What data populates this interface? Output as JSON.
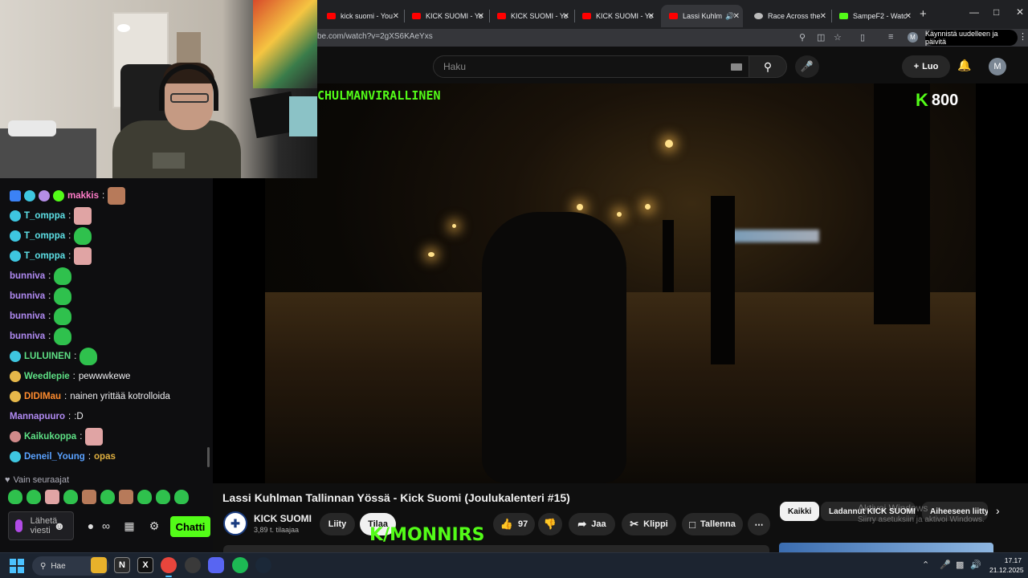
{
  "browser": {
    "tabs": [
      {
        "label": "kick suomi - You",
        "favicon": "youtube-icon"
      },
      {
        "label": "KICK SUOMI - Yo",
        "favicon": "youtube-icon"
      },
      {
        "label": "KICK SUOMI - Yo",
        "favicon": "youtube-icon"
      },
      {
        "label": "KICK SUOMI - Yo",
        "favicon": "youtube-icon"
      },
      {
        "label": "Lassi Kuhlm",
        "favicon": "youtube-icon",
        "active": true
      },
      {
        "label": "Race Across the",
        "favicon": "race-icon"
      },
      {
        "label": "SampeF2 - Watc",
        "favicon": "kick-icon"
      }
    ],
    "url": "be.com/watch?v=2gXS6KAeYxs",
    "restart_label": "Käynnistä uudelleen ja päivitä",
    "profile_initial": "M"
  },
  "youtube": {
    "search_placeholder": "Haku",
    "create_label": "Luo",
    "avatar_initial": "M"
  },
  "video": {
    "channel_overlay": "CHULMANVIRALLINEN",
    "kick_viewer_count": "800",
    "kick_k": "K",
    "stream_watermark": "K/MONNIRS",
    "title": "Lassi Kuhlman Tallinnan Yössä - Kick Suomi (Joulukalenteri #15)",
    "channel_name": "KICK SUOMI",
    "channel_subs": "3,89 t. tilaajaa",
    "join_label": "Liity",
    "subscribe_label": "Tilaa",
    "likes": "97",
    "share_label": "Jaa",
    "clip_label": "Klippi",
    "save_label": "Tallenna"
  },
  "chips": {
    "items": [
      "Kaikki",
      "Ladannut KICK SUOMI",
      "Aiheeseen liitty"
    ],
    "active": "Kaikki"
  },
  "windows_watermark": {
    "line1": "Aktivoi Windows",
    "line2": "Siirry asetuksiin ja aktivoi Windows."
  },
  "chat": {
    "messages": [
      {
        "user": "makkis",
        "text": ""
      },
      {
        "user": "T_omppa",
        "text": ""
      },
      {
        "user": "T_omppa",
        "text": ""
      },
      {
        "user": "T_omppa",
        "text": ""
      },
      {
        "user": "bunniva",
        "text": ""
      },
      {
        "user": "bunniva",
        "text": ""
      },
      {
        "user": "bunniva",
        "text": ""
      },
      {
        "user": "bunniva",
        "text": ""
      },
      {
        "user": "LULUINEN",
        "text": ""
      },
      {
        "user": "Weedlepie",
        "text": "pewwwkewe"
      },
      {
        "user": "DIDIMau",
        "text": "nainen yrittää kotrolloida"
      },
      {
        "user": "Mannapuuro",
        "text": ":D"
      },
      {
        "user": "Kaikukoppa",
        "text": ""
      },
      {
        "user": "Deneil_Young",
        "text": "opas"
      }
    ],
    "followers_only": "Vain seuraajat",
    "send_placeholder": "Lähetä viesti",
    "chat_button": "Chatti"
  },
  "taskbar": {
    "search_label": "Hae",
    "time": "17.17",
    "date": "21.12.2025"
  },
  "colors": {
    "kick_green": "#53fc18",
    "youtube_red": "#ff0000",
    "background": "#0f0f0f"
  }
}
